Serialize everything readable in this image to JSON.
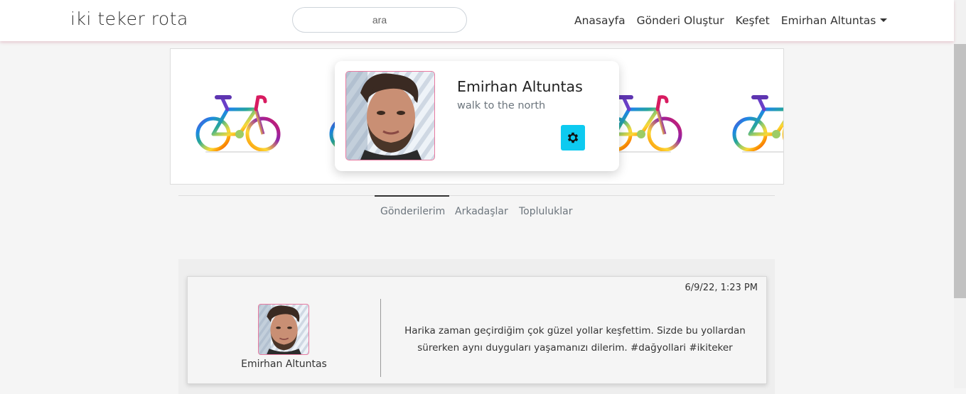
{
  "navbar": {
    "brand": "iki teker rota",
    "search_placeholder": "ara",
    "links": [
      "Anasayfa",
      "Gönderi Oluştur",
      "Keşfet"
    ],
    "user_menu": "Emirhan Altuntas"
  },
  "profile": {
    "name": "Emirhan Altuntas",
    "bio": "walk to the north",
    "settings_icon": "gear-icon",
    "settings_color": "#0dcaf0"
  },
  "cover": {
    "pattern_icon": "bicycle-icon"
  },
  "tabs": {
    "items": [
      "Gönderilerim",
      "Arkadaşlar",
      "Topluluklar"
    ],
    "active": "Gönderilerim"
  },
  "posts": [
    {
      "author": "Emirhan Altuntas",
      "timestamp": "6/9/22, 1:23 PM",
      "text": "Harika zaman geçirdiğim çok güzel yollar keşfettim. Sizde bu yollardan sürerken aynı duyguları yaşamanızı dilerim. #dağyollari #ikiteker"
    }
  ],
  "colors": {
    "accent": "#0dcaf0",
    "avatar_border": "#e87aa0"
  }
}
